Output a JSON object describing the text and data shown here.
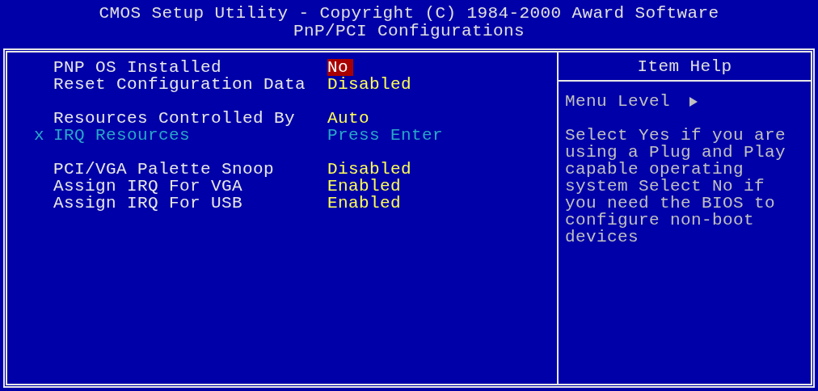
{
  "header": {
    "title": "CMOS Setup Utility - Copyright (C) 1984-2000 Award Software",
    "subtitle": "PnP/PCI Configurations"
  },
  "settings": {
    "groups": [
      [
        {
          "label": "PNP OS Installed",
          "value": "No",
          "selected": true,
          "disabled": false
        },
        {
          "label": "Reset Configuration Data",
          "value": "Disabled",
          "selected": false,
          "disabled": false
        }
      ],
      [
        {
          "label": "Resources Controlled By",
          "value": "Auto",
          "selected": false,
          "disabled": false
        },
        {
          "prefix": "x",
          "label": "IRQ Resources",
          "value": "Press Enter",
          "selected": false,
          "disabled": true
        }
      ],
      [
        {
          "label": "PCI/VGA Palette Snoop",
          "value": "Disabled",
          "selected": false,
          "disabled": false
        },
        {
          "label": "Assign IRQ For VGA",
          "value": "Enabled",
          "selected": false,
          "disabled": false
        },
        {
          "label": "Assign IRQ For USB",
          "value": "Enabled",
          "selected": false,
          "disabled": false
        }
      ]
    ]
  },
  "help": {
    "title": "Item Help",
    "menu_level": "Menu Level",
    "text": "Select Yes if you are using a Plug and Play capable operating system Select No if you need the BIOS to configure non-boot devices"
  }
}
